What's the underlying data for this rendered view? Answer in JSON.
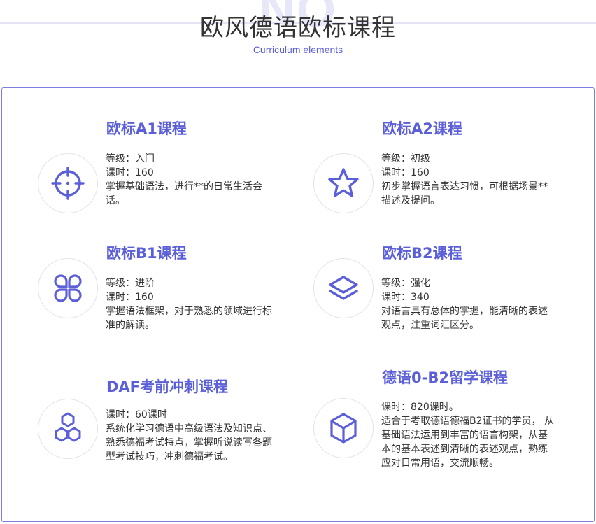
{
  "header": {
    "watermark": "NO",
    "title": "欧风德语欧标课程",
    "subtitle": "Curriculum elements"
  },
  "icons": {
    "a1": "crosshair-icon",
    "a2": "star-icon",
    "b1": "four-leaf-icon",
    "b2": "layers-icon",
    "daf": "hexagons-icon",
    "zero_b2": "cube-icon"
  },
  "accent_color": "#5b5fd8",
  "courses": {
    "a1": {
      "title": "欧标A1课程",
      "lines": [
        "等级：入门",
        "课时：160",
        "掌握基础语法，进行**的日常生活会话。"
      ]
    },
    "a2": {
      "title": "欧标A2课程",
      "lines": [
        "等级：初级",
        "课时：160",
        "初步掌握语言表达习惯，可根据场景**描述及提问。"
      ]
    },
    "b1": {
      "title": "欧标B1课程",
      "lines": [
        "等级：进阶",
        "课时：160",
        "掌握语法框架，对于熟悉的领域进行标准的解读。"
      ]
    },
    "b2": {
      "title": "欧标B2课程",
      "lines": [
        "等级：强化",
        "课时：340",
        "对语言具有总体的掌握，能清晰的表述观点，注重词汇区分。"
      ]
    },
    "daf": {
      "title": "DAF考前冲刺课程",
      "lines": [
        "课时：60课时",
        "系统化学习德语中高级语法及知识点、熟悉德福考试特点，掌握听说读写各题型考试技巧，冲刺德福考试。"
      ]
    },
    "zero_b2": {
      "title": "德语0-B2留学课程",
      "lines": [
        "课时：820课时。",
        "适合于考取德语德福B2证书的学员， 从基础语法运用到丰富的语言构架，从基本的基本表述到清晰的表述观点，熟练应对日常用语，交流顺畅。"
      ]
    }
  }
}
